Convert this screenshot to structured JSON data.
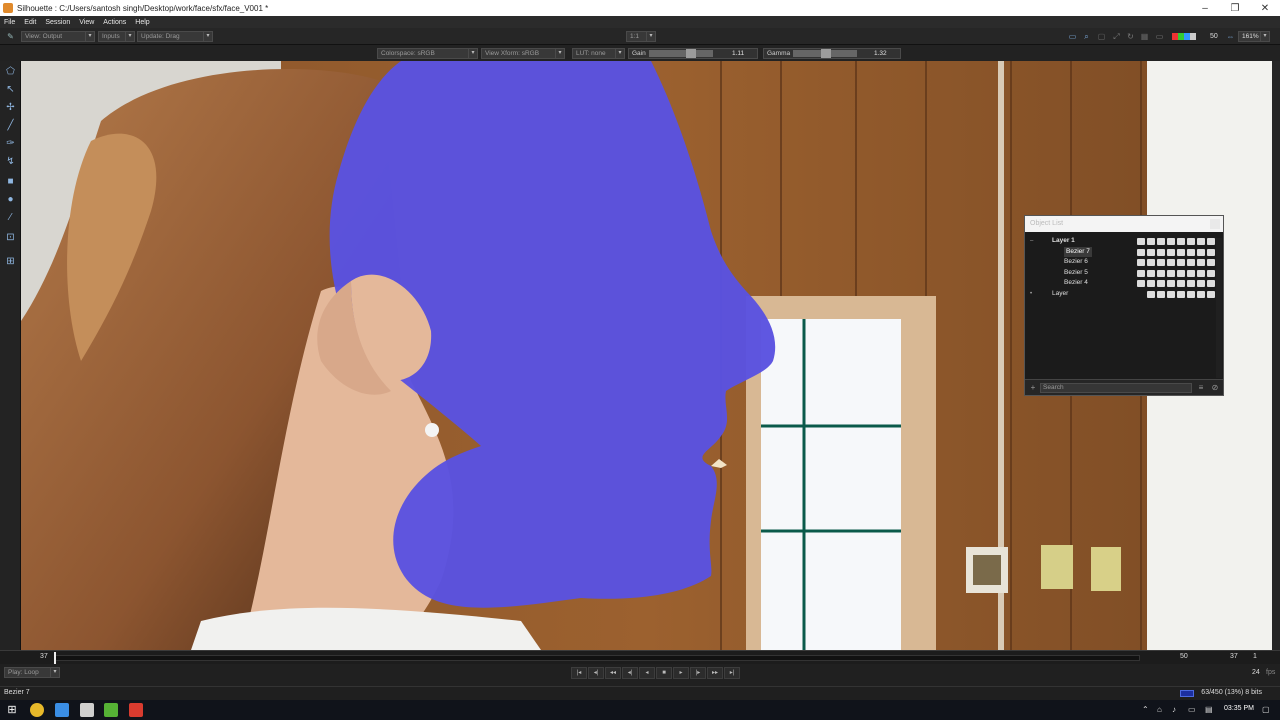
{
  "window": {
    "title": "Silhouette : C:/Users/santosh singh/Desktop/work/face/sfx/face_V001 *",
    "min": "–",
    "max": "❐",
    "close": "✕"
  },
  "menu": [
    "File",
    "Edit",
    "Session",
    "View",
    "Actions",
    "Help"
  ],
  "toolbar": {
    "view_output": "View: Output",
    "inputs": "Inputs",
    "update": "Update: Drag",
    "ratio": "1:1",
    "frame_value": "50",
    "zoom": "161%"
  },
  "viewer_controls": {
    "colorspace": "Colorspace: sRGB",
    "view_xform": "View Xform: sRGB",
    "lut": "LUT: none",
    "gain_label": "Gain",
    "gain_value": "1.11",
    "gamma_label": "Gamma",
    "gamma_value": "1.32"
  },
  "object_list": {
    "title": "Object List",
    "rows": [
      {
        "label": "Layer 1",
        "level": 0,
        "selected": false
      },
      {
        "label": "Bezier 7",
        "level": 1,
        "selected": true
      },
      {
        "label": "Bezier 6",
        "level": 1,
        "selected": false
      },
      {
        "label": "Bezier 5",
        "level": 1,
        "selected": false
      },
      {
        "label": "Bezier 4",
        "level": 1,
        "selected": false
      },
      {
        "label": "Layer",
        "level": 0,
        "selected": false
      }
    ],
    "search_placeholder": "Search"
  },
  "timeline": {
    "current_frame": "37",
    "end_frame": "50",
    "frame_display": "37",
    "step": "1"
  },
  "transport": {
    "play_mode": "Play: Loop",
    "fps": "24",
    "fps_unit": "fps"
  },
  "status": {
    "selection": "Bezier 7",
    "cache": "63/450 (13%) 8 bits"
  },
  "taskbar": {
    "clock": "03:35 PM"
  },
  "colors": {
    "matte": "#5a52e0",
    "accent": "#3a78d8"
  }
}
